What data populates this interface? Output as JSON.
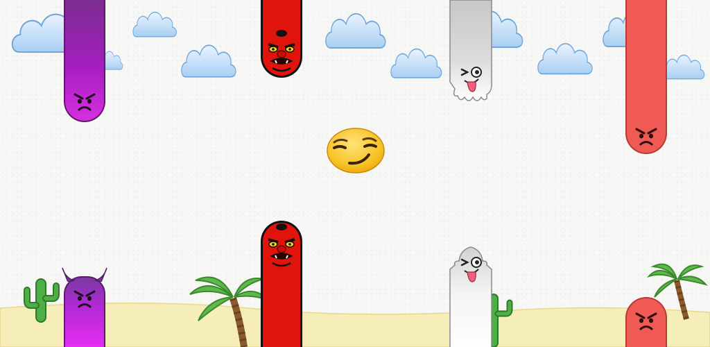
{
  "game": {
    "player": {
      "emoji": "smirking-face",
      "color": "#f7c325"
    },
    "obstacles": [
      {
        "column": 1,
        "top_character": "angry-face",
        "bottom_character": "angry-face-with-horns",
        "color": "#a51ec0"
      },
      {
        "column": 2,
        "top_character": "goblin-mask",
        "bottom_character": "goblin-mask",
        "color": "#e0140c"
      },
      {
        "column": 3,
        "top_character": "winking-ghost",
        "bottom_character": "winking-ghost",
        "color": "#c9c9c9"
      },
      {
        "column": 4,
        "top_character": "angry-face",
        "bottom_character": "angry-face",
        "color": "#ef5a55"
      }
    ],
    "scenery": [
      "cloud",
      "cactus",
      "palm-tree",
      "desert-sand"
    ]
  }
}
